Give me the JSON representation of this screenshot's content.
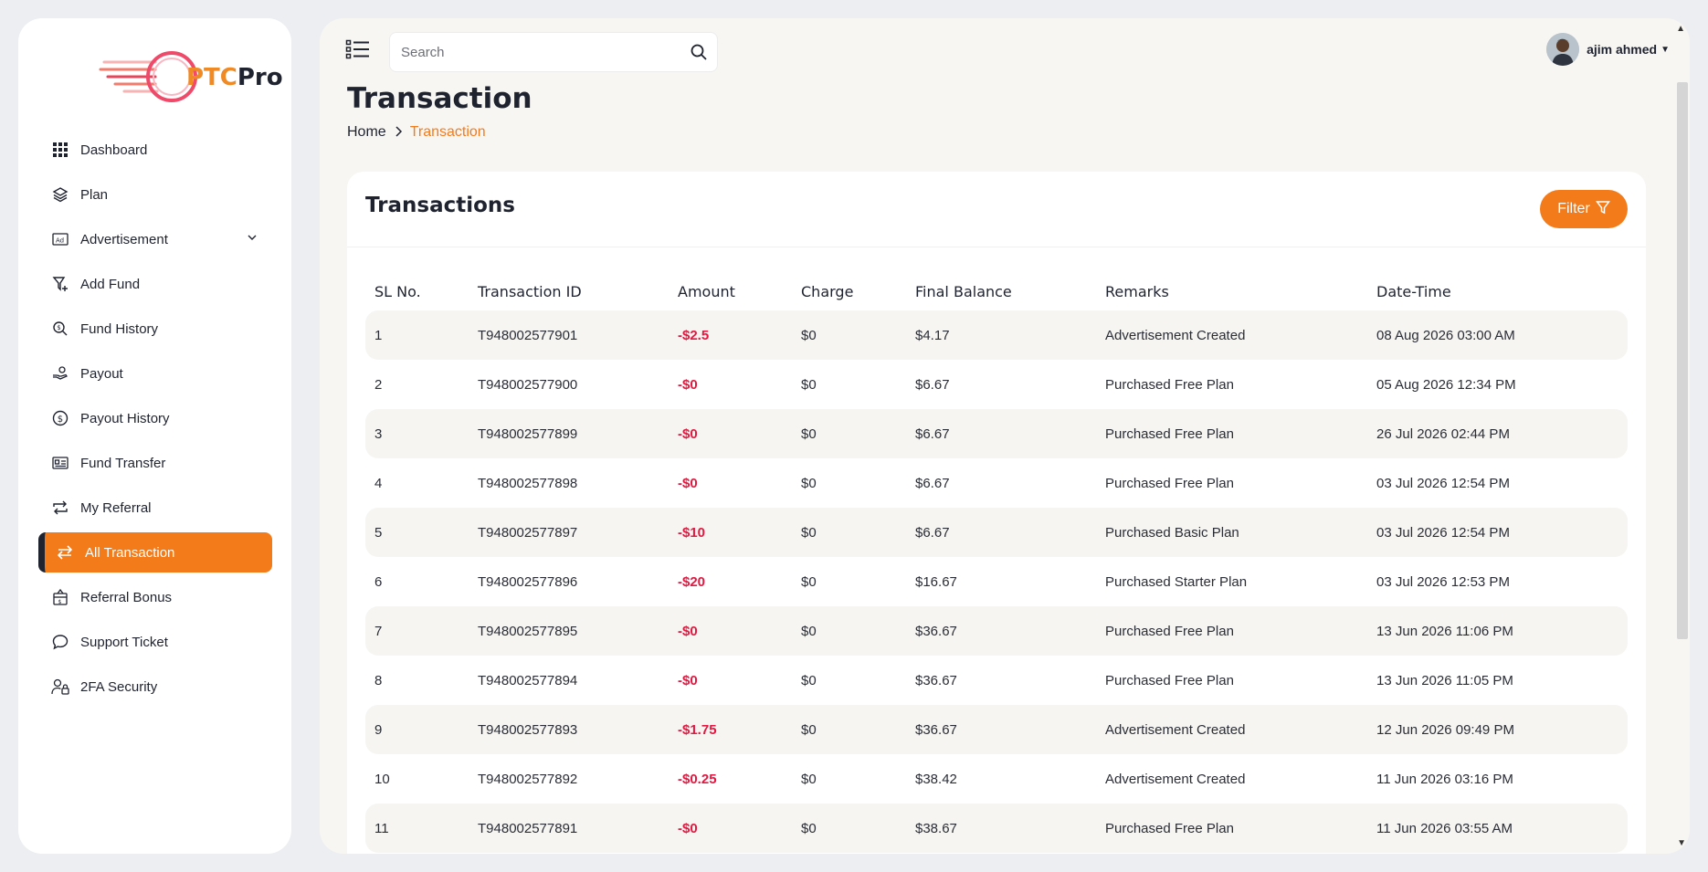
{
  "brand": {
    "name_accent": "PTC",
    "name_rest": "Pro"
  },
  "sidebar": {
    "items": [
      {
        "label": "Dashboard",
        "icon": "grid-icon"
      },
      {
        "label": "Plan",
        "icon": "layers-icon"
      },
      {
        "label": "Advertisement",
        "icon": "ad-icon",
        "has_chevron": true
      },
      {
        "label": "Add Fund",
        "icon": "funnel-plus-icon"
      },
      {
        "label": "Fund History",
        "icon": "search-dollar-icon"
      },
      {
        "label": "Payout",
        "icon": "hand-coin-icon"
      },
      {
        "label": "Payout History",
        "icon": "dollar-circle-icon"
      },
      {
        "label": "Fund Transfer",
        "icon": "id-card-icon"
      },
      {
        "label": "My Referral",
        "icon": "repeat-icon"
      },
      {
        "label": "All Transaction",
        "icon": "swap-icon",
        "active": true
      },
      {
        "label": "Referral Bonus",
        "icon": "gift-dollar-icon"
      },
      {
        "label": "Support Ticket",
        "icon": "chat-icon"
      },
      {
        "label": "2FA Security",
        "icon": "user-lock-icon"
      }
    ]
  },
  "header": {
    "search_placeholder": "Search",
    "user_name": "ajim ahmed"
  },
  "page": {
    "title": "Transaction",
    "breadcrumb_home": "Home",
    "breadcrumb_current": "Transaction"
  },
  "card": {
    "title": "Transactions",
    "filter_label": "Filter"
  },
  "colors": {
    "accent": "#f47b1a",
    "negative": "#e3173f",
    "dark": "#1f2330"
  },
  "table": {
    "columns": [
      "SL No.",
      "Transaction ID",
      "Amount",
      "Charge",
      "Final Balance",
      "Remarks",
      "Date-Time"
    ],
    "rows": [
      [
        "1",
        "T948002577901",
        "-$2.5",
        "$0",
        "$4.17",
        "Advertisement Created",
        "08 Aug 2026 03:00 AM"
      ],
      [
        "2",
        "T948002577900",
        "-$0",
        "$0",
        "$6.67",
        "Purchased Free Plan",
        "05 Aug 2026 12:34 PM"
      ],
      [
        "3",
        "T948002577899",
        "-$0",
        "$0",
        "$6.67",
        "Purchased Free Plan",
        "26 Jul 2026 02:44 PM"
      ],
      [
        "4",
        "T948002577898",
        "-$0",
        "$0",
        "$6.67",
        "Purchased Free Plan",
        "03 Jul 2026 12:54 PM"
      ],
      [
        "5",
        "T948002577897",
        "-$10",
        "$0",
        "$6.67",
        "Purchased Basic Plan",
        "03 Jul 2026 12:54 PM"
      ],
      [
        "6",
        "T948002577896",
        "-$20",
        "$0",
        "$16.67",
        "Purchased Starter Plan",
        "03 Jul 2026 12:53 PM"
      ],
      [
        "7",
        "T948002577895",
        "-$0",
        "$0",
        "$36.67",
        "Purchased Free Plan",
        "13 Jun 2026 11:06 PM"
      ],
      [
        "8",
        "T948002577894",
        "-$0",
        "$0",
        "$36.67",
        "Purchased Free Plan",
        "13 Jun 2026 11:05 PM"
      ],
      [
        "9",
        "T948002577893",
        "-$1.75",
        "$0",
        "$36.67",
        "Advertisement Created",
        "12 Jun 2026 09:49 PM"
      ],
      [
        "10",
        "T948002577892",
        "-$0.25",
        "$0",
        "$38.42",
        "Advertisement Created",
        "11 Jun 2026 03:16 PM"
      ],
      [
        "11",
        "T948002577891",
        "-$0",
        "$0",
        "$38.67",
        "Purchased Free Plan",
        "11 Jun 2026 03:55 AM"
      ]
    ]
  }
}
